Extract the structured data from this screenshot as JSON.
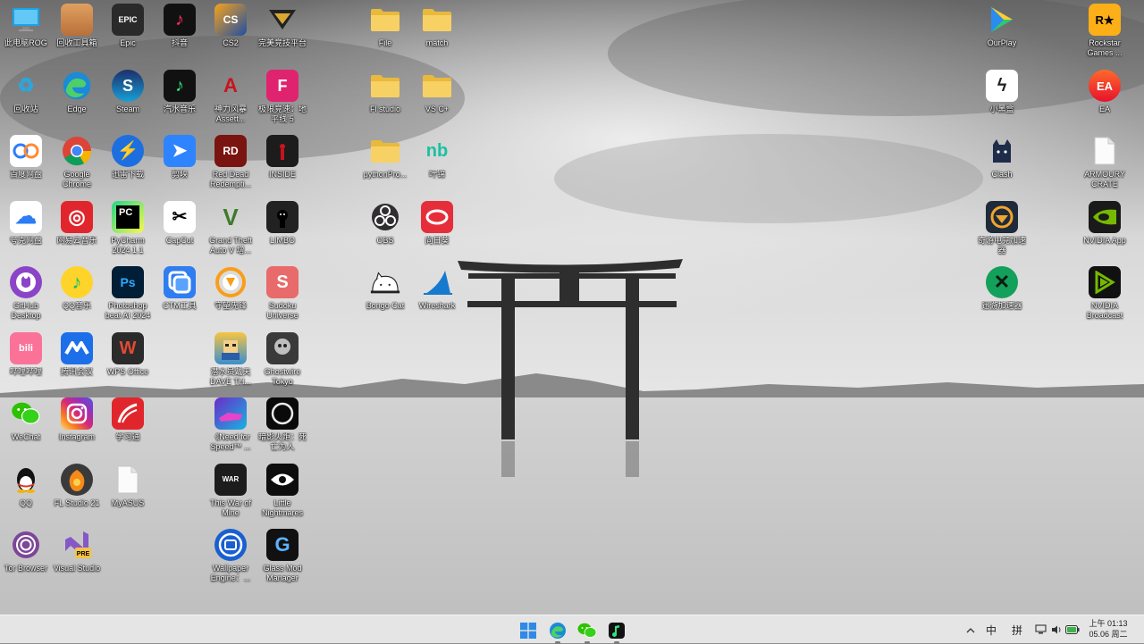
{
  "desktop": {
    "icons": [
      {
        "label": "此电脑ROG",
        "icon": "computer-icon"
      },
      {
        "label": "回收工具箱",
        "icon": "toolbox-icon"
      },
      {
        "label": "Epic",
        "icon": "epic-games-icon",
        "glyph": "EPIC"
      },
      {
        "label": "抖音",
        "icon": "douyin-icon",
        "glyph": "♪"
      },
      {
        "label": "CS2",
        "icon": "cs2-icon",
        "glyph": "CS"
      },
      {
        "label": "完美竞技平台",
        "icon": "perfect-world-arena-icon"
      },
      {
        "label": "File",
        "icon": "folder-icon"
      },
      {
        "label": "match",
        "icon": "folder-icon"
      },
      {
        "label": "OurPlay",
        "icon": "ourplay-icon"
      },
      {
        "label": "Rockstar Games ...",
        "icon": "rockstar-icon",
        "glyph": "R★"
      },
      {
        "label": "回收站",
        "icon": "recycle-bin-icon",
        "glyph": "♻"
      },
      {
        "label": "Edge",
        "icon": "edge-icon"
      },
      {
        "label": "Steam",
        "icon": "steam-icon",
        "glyph": "S"
      },
      {
        "label": "汽水音乐",
        "icon": "qishui-music-icon",
        "glyph": "♪"
      },
      {
        "label": "神力风暴 Assett...",
        "icon": "assetto-corsa-icon",
        "glyph": "A"
      },
      {
        "label": "极限竞速：地平线 5",
        "icon": "forza-horizon-icon",
        "glyph": "F"
      },
      {
        "label": "Fl studio",
        "icon": "folder-icon"
      },
      {
        "label": "VS C+",
        "icon": "folder-icon"
      },
      {
        "label": "小黑盒",
        "icon": "heybox-icon",
        "glyph": "ϟ"
      },
      {
        "label": "EA",
        "icon": "ea-icon",
        "glyph": "EA"
      },
      {
        "label": "百度网盘",
        "icon": "baidu-netdisk-icon"
      },
      {
        "label": "Google Chrome",
        "icon": "chrome-icon"
      },
      {
        "label": "迅雷下载",
        "icon": "xunlei-icon",
        "glyph": "⚡"
      },
      {
        "label": "剪映",
        "icon": "jianying-icon",
        "glyph": "➤"
      },
      {
        "label": "Red Dead Redempti...",
        "icon": "red-dead-icon",
        "glyph": "RD"
      },
      {
        "label": "INSIDE",
        "icon": "inside-icon"
      },
      {
        "label": "pythonPro...",
        "icon": "folder-icon"
      },
      {
        "label": "叶锦",
        "icon": "nb-icon",
        "glyph": "nb"
      },
      {
        "label": "Clash",
        "icon": "clash-cat-icon",
        "glyph": "🐈"
      },
      {
        "label": "ARMOURY CRATE",
        "icon": "file-icon"
      },
      {
        "label": "夸克网盘",
        "icon": "quark-cloud-icon",
        "glyph": "☁"
      },
      {
        "label": "网易云音乐",
        "icon": "netease-music-icon",
        "glyph": "◎"
      },
      {
        "label": "PyCharm 2024.1.1",
        "icon": "pycharm-icon",
        "glyph": "PC"
      },
      {
        "label": "CapCut",
        "icon": "capcut-icon",
        "glyph": "✂"
      },
      {
        "label": "Grand Theft Auto V 增...",
        "icon": "gta-v-icon",
        "glyph": "V"
      },
      {
        "label": "LIMBO",
        "icon": "limbo-icon"
      },
      {
        "label": "OBS",
        "icon": "obs-icon"
      },
      {
        "label": "向日葵",
        "icon": "sunflower-icon"
      },
      {
        "label": "奇游电竞加速器",
        "icon": "qiyou-accelerator-icon"
      },
      {
        "label": "NVIDIA App",
        "icon": "nvidia-icon"
      },
      {
        "label": "GitHub Desktop",
        "icon": "github-icon"
      },
      {
        "label": "QQ音乐",
        "icon": "qq-music-icon",
        "glyph": "♪"
      },
      {
        "label": "Photoshop beat AI 2024",
        "icon": "photoshop-icon",
        "glyph": "Ps"
      },
      {
        "label": "CTM工具",
        "icon": "ctm-tool-icon"
      },
      {
        "label": "守望先锋",
        "icon": "overwatch-icon"
      },
      {
        "label": "Sudoku Universe",
        "icon": "sudoku-icon",
        "glyph": "S"
      },
      {
        "label": "Bongo Cat",
        "icon": "bongo-cat-icon"
      },
      {
        "label": "Wireshark",
        "icon": "wireshark-icon"
      },
      {
        "label": "迅游加速器",
        "icon": "xunyou-accelerator-icon",
        "glyph": "✕"
      },
      {
        "label": "NVIDIA Broadcast",
        "icon": "nvidia-broadcast-icon"
      },
      {
        "label": "哔哩哔哩",
        "icon": "bilibili-icon",
        "glyph": "bili"
      },
      {
        "label": "腾讯会议",
        "icon": "tencent-meeting-icon"
      },
      {
        "label": "WPS Office",
        "icon": "wps-icon",
        "glyph": "W"
      },
      {
        "label": "潜水员戴夫 DAVE TH...",
        "icon": "dave-the-diver-icon"
      },
      {
        "label": "Ghostwire Tokyo",
        "icon": "ghostwire-icon"
      },
      {
        "label": "WeChat",
        "icon": "wechat-icon"
      },
      {
        "label": "Instagram",
        "icon": "instagram-icon"
      },
      {
        "label": "学习通",
        "icon": "xuexitong-icon"
      },
      {
        "label": "《Need for Speed™ ...",
        "icon": "need-for-speed-icon"
      },
      {
        "label": "暗影火炬：死亡为人",
        "icon": "ring-game-icon"
      },
      {
        "label": "QQ",
        "icon": "qq-icon"
      },
      {
        "label": "FL Studio 21",
        "icon": "fl-studio-icon"
      },
      {
        "label": "MyASUS",
        "icon": "file-icon"
      },
      {
        "label": "This War of Mine",
        "icon": "this-war-of-mine-icon"
      },
      {
        "label": "Little Nightmares",
        "icon": "little-nightmares-icon"
      },
      {
        "label": "Tor Browser",
        "icon": "tor-browser-icon"
      },
      {
        "label": "Visual Studio",
        "icon": "visual-studio-icon",
        "glyph": "PRE"
      },
      {
        "label": "Wallpaper Engine：...",
        "icon": "wallpaper-engine-icon"
      },
      {
        "label": "Glass Mod Manager",
        "icon": "glass-mod-manager-icon",
        "glyph": "G"
      }
    ]
  },
  "taskbar": {
    "apps": [
      {
        "name": "start-button",
        "icon": "windows-start-icon"
      },
      {
        "name": "taskbar-edge",
        "icon": "edge-icon"
      },
      {
        "name": "taskbar-wechat",
        "icon": "wechat-icon"
      },
      {
        "name": "taskbar-qishui",
        "icon": "qishui-music-icon"
      }
    ],
    "tray": {
      "chevron": "^",
      "ime_lang": "中",
      "ime_mode": "拼",
      "clock_time": "上午 01:13",
      "clock_date": "05.06 周二"
    }
  }
}
